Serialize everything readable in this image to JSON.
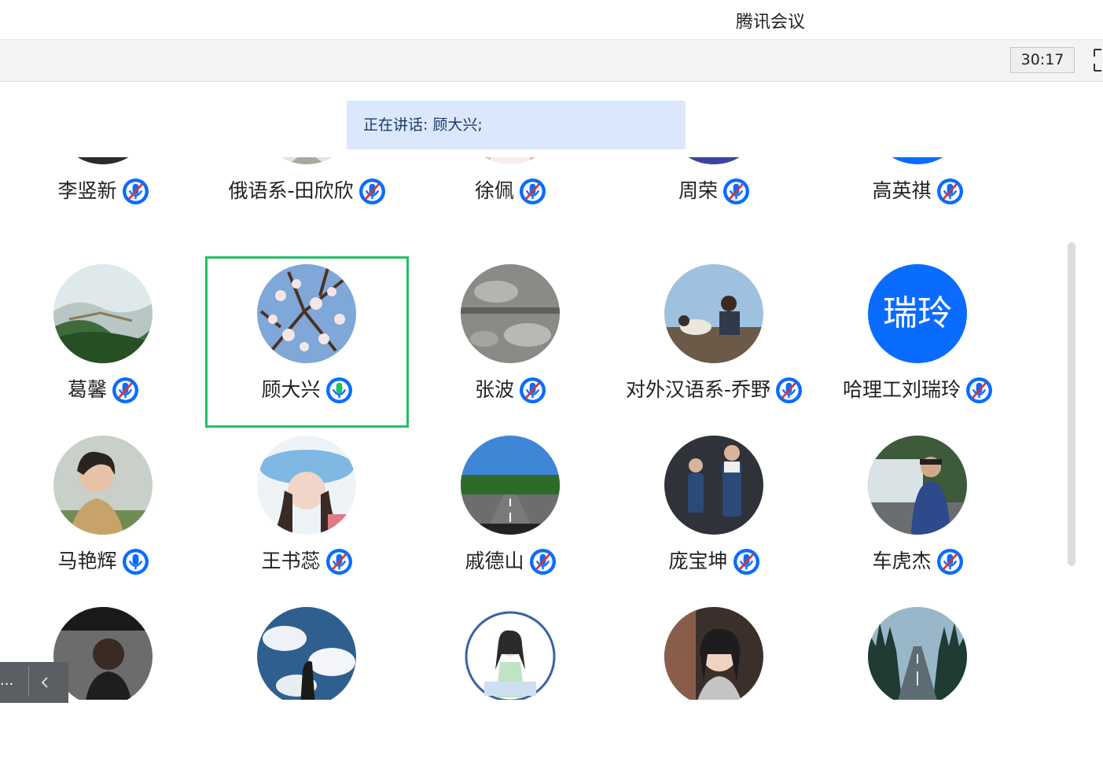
{
  "window": {
    "title": "腾讯会议"
  },
  "toolbar": {
    "timer": "30:17",
    "fullscreen_icon": "fullscreen-icon"
  },
  "speaking": {
    "label": "正在讲话:",
    "speaker": "顾大兴;"
  },
  "float_panel": {
    "label": "...",
    "icon": "chevron-left-icon"
  },
  "colors": {
    "accent": "#0a6cff",
    "active_border": "#21c063",
    "mic_on": "#21c063",
    "muted_slash": "#e0322f"
  },
  "participants": [
    {
      "name": "李竖新",
      "muted": true,
      "avatar": "partial-avatar"
    },
    {
      "name": "俄语系-田欣欣",
      "muted": true,
      "avatar": "partial-avatar"
    },
    {
      "name": "徐佩",
      "muted": true,
      "avatar": "partial-avatar"
    },
    {
      "name": "周荣",
      "muted": true,
      "avatar": "partial-avatar"
    },
    {
      "name": "高英祺",
      "muted": true,
      "avatar": "partial-avatar"
    },
    {
      "name": "葛馨",
      "muted": true,
      "avatar": "great-wall-photo"
    },
    {
      "name": "顾大兴",
      "muted": false,
      "speaking": true,
      "active": true,
      "avatar": "blossom-photo"
    },
    {
      "name": "张波",
      "muted": true,
      "avatar": "stone-carving-photo"
    },
    {
      "name": "对外汉语系-乔野",
      "muted": true,
      "avatar": "man-with-dog-photo"
    },
    {
      "name": "哈理工刘瑞玲",
      "muted": true,
      "avatar_text": "瑞玲"
    },
    {
      "name": "马艳辉",
      "muted": false,
      "avatar": "woman-portrait-photo"
    },
    {
      "name": "王书蕊",
      "muted": true,
      "avatar": "woman-hat-photo"
    },
    {
      "name": "戚德山",
      "muted": true,
      "avatar": "road-photo"
    },
    {
      "name": "庞宝坤",
      "muted": true,
      "avatar": "parent-child-photo"
    },
    {
      "name": "车虎杰",
      "muted": true,
      "avatar": "man-waterfall-photo"
    },
    {
      "name": "",
      "muted": true,
      "avatar": "dark-portrait-photo"
    },
    {
      "name": "",
      "muted": true,
      "avatar": "clouds-silhouette-photo"
    },
    {
      "name": "",
      "muted": true,
      "avatar": "cartoon-girl-logo"
    },
    {
      "name": "",
      "muted": true,
      "avatar": "woman-selfie-photo"
    },
    {
      "name": "",
      "muted": true,
      "avatar": "forest-road-photo"
    }
  ]
}
